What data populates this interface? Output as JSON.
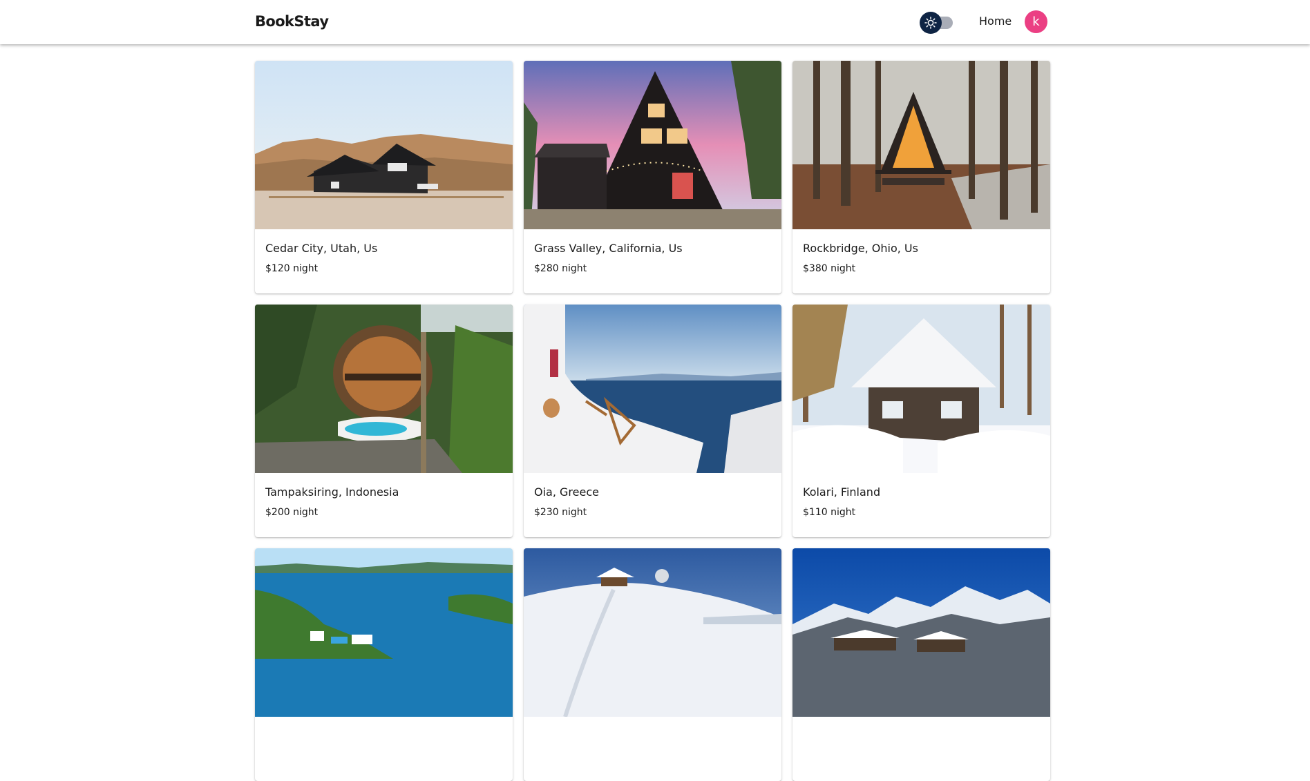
{
  "header": {
    "brand": "BookStay",
    "nav_home": "Home",
    "avatar_initial": "k",
    "theme_toggle_icon": "sun-icon"
  },
  "colors": {
    "avatar": "#eb3f83",
    "toggle_knob": "#0e2444",
    "toggle_track": "#a9adb7"
  },
  "listings": [
    {
      "location": "Cedar City, Utah, Us",
      "price": "$120 night",
      "image": "dark farmhouse in desert hills"
    },
    {
      "location": "Grass Valley, California, Us",
      "price": "$280 night",
      "image": "black a-frame cabin with string lights"
    },
    {
      "location": "Rockbridge, Ohio, Us",
      "price": "$380 night",
      "image": "glowing a-frame in forest"
    },
    {
      "location": "Tampaksiring, Indonesia",
      "price": "$200 night",
      "image": "round bamboo house with pool in jungle"
    },
    {
      "location": "Oia, Greece",
      "price": "$230 night",
      "image": "white terrace with sun loungers over sea"
    },
    {
      "location": "Kolari, Finland",
      "price": "$110 night",
      "image": "snowy log cabin"
    },
    {
      "location": "",
      "price": "",
      "image": "tropical bay with white villas"
    },
    {
      "location": "",
      "price": "",
      "image": "chalet on snowy hillside"
    },
    {
      "location": "",
      "price": "",
      "image": "alpine village under snowy peaks"
    }
  ]
}
